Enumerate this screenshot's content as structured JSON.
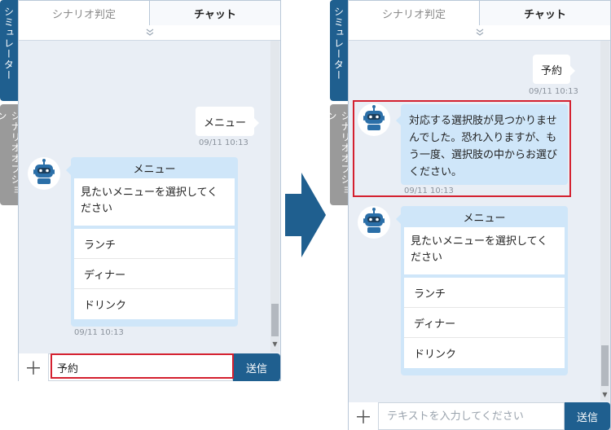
{
  "tabs": {
    "scenario": "シナリオ判定",
    "chat": "チャット"
  },
  "side_tabs": {
    "simulator": "シミュレーター",
    "scenario_option": "シナリオオプション"
  },
  "collapse_icon": "chevron-double-down-icon",
  "left": {
    "user_message": {
      "text": "メニュー",
      "time": "09/11 10:13"
    },
    "bot_card": {
      "title": "メニュー",
      "prompt": "見たいメニューを選択してください",
      "options": [
        "ランチ",
        "ディナー",
        "ドリンク"
      ],
      "time": "09/11 10:13"
    },
    "input": {
      "value": "予約"
    },
    "send_label": "送信"
  },
  "right": {
    "user_message": {
      "text": "予約",
      "time": "09/11 10:13"
    },
    "bot_message": {
      "text": "対応する選択肢が見つかりませんでした。恐れ入りますが、もう一度、選択肢の中からお選びください。",
      "time": "09/11 10:13"
    },
    "bot_card": {
      "title": "メニュー",
      "prompt": "見たいメニューを選択してください",
      "options": [
        "ランチ",
        "ディナー",
        "ドリンク"
      ]
    },
    "input": {
      "value": "",
      "placeholder": "テキストを入力してください"
    },
    "send_label": "送信"
  },
  "colors": {
    "accent": "#1f5f8f",
    "highlight": "#d4202f",
    "bot_bubble": "#cfe6f9",
    "chat_bg": "#e9eef5"
  }
}
